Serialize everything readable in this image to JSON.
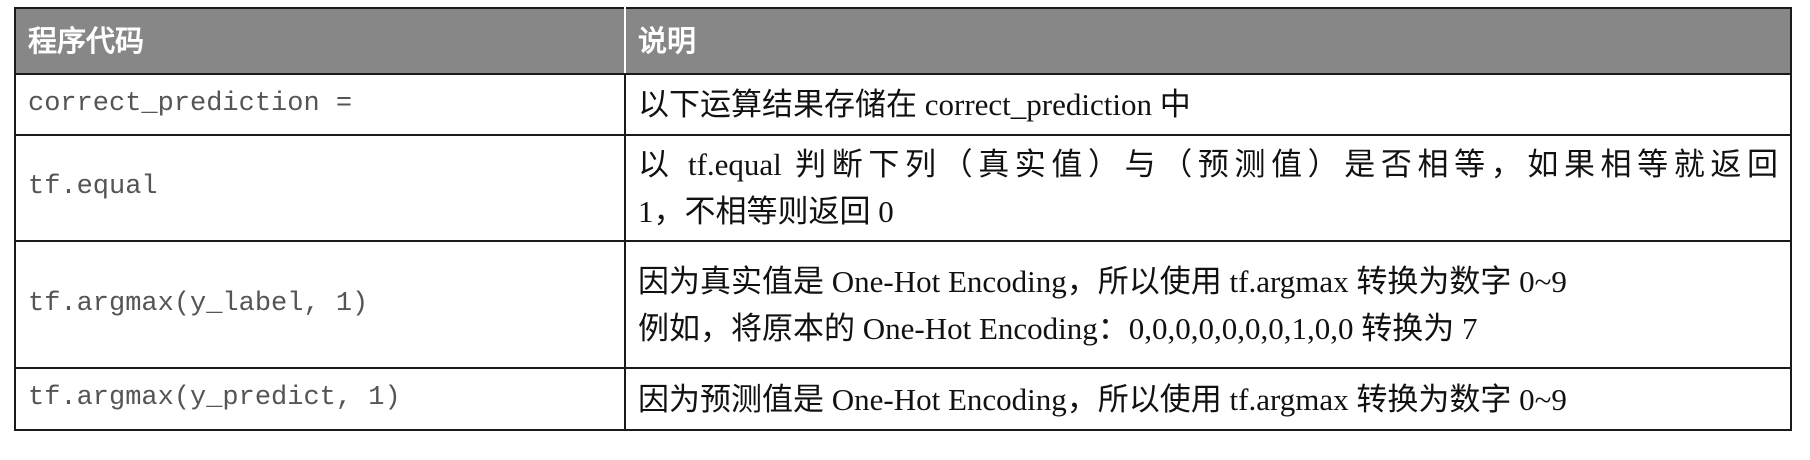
{
  "table": {
    "headers": [
      "程序代码",
      "说明"
    ],
    "rows": [
      {
        "code": "correct_prediction =",
        "desc_lines": [
          "以下运算结果存储在 correct_prediction 中"
        ]
      },
      {
        "code": "tf.equal",
        "desc_lines": [
          "以 tf.equal 判断下列（真实值）与（预测值）是否相等，如果相等就返回",
          "1，不相等则返回 0"
        ]
      },
      {
        "code": "tf.argmax(y_label, 1)",
        "desc_lines": [
          "因为真实值是 One-Hot Encoding，所以使用 tf.argmax 转换为数字 0~9",
          "例如，将原本的 One-Hot Encoding：0,0,0,0,0,0,0,1,0,0 转换为 7"
        ]
      },
      {
        "code": "tf.argmax(y_predict, 1)",
        "desc_lines": [
          "因为预测值是 One-Hot Encoding，所以使用 tf.argmax 转换为数字 0~9"
        ]
      }
    ]
  }
}
